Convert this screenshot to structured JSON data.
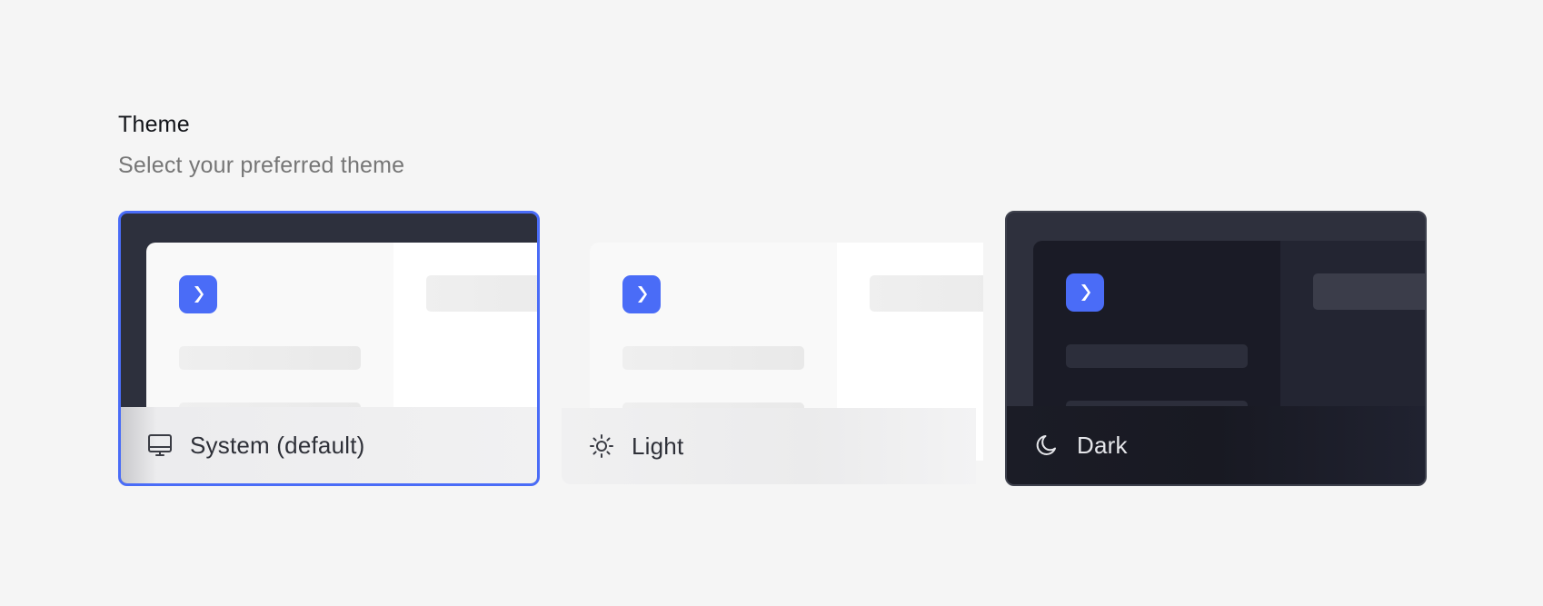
{
  "theme_section": {
    "title": "Theme",
    "subtitle": "Select your preferred theme"
  },
  "options": [
    {
      "label": "System (default)",
      "icon": "monitor-icon",
      "selected": true
    },
    {
      "label": "Light",
      "icon": "sun-icon",
      "selected": false
    },
    {
      "label": "Dark",
      "icon": "moon-icon",
      "selected": false
    }
  ],
  "colors": {
    "accent": "#4a6cf7",
    "background": "#f5f5f5"
  }
}
